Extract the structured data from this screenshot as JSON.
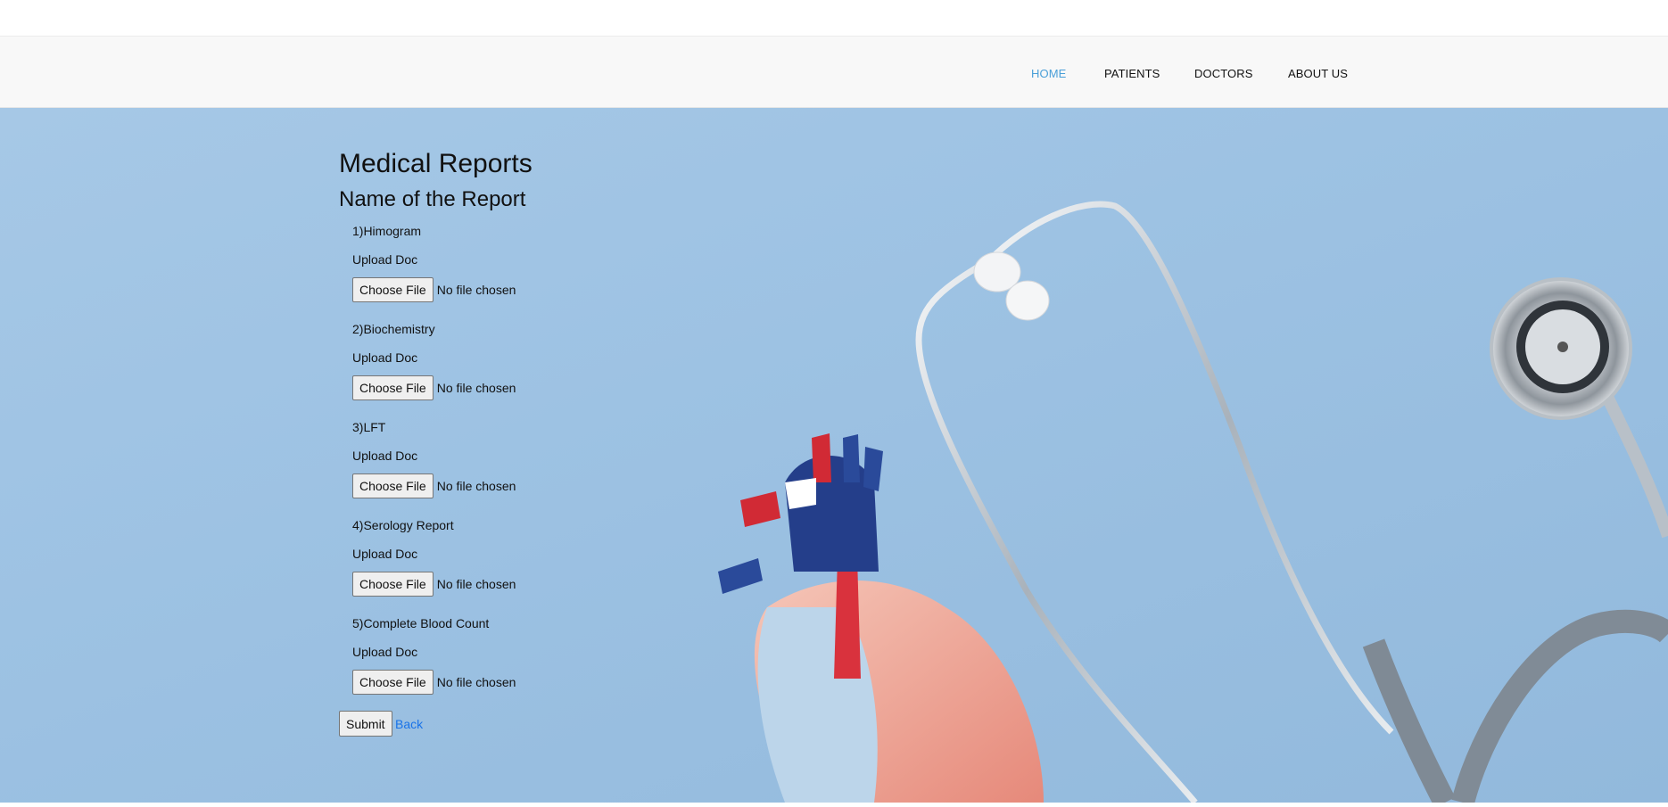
{
  "nav": {
    "items": [
      {
        "label": "HOME",
        "active": true
      },
      {
        "label": "PATIENTS",
        "active": false
      },
      {
        "label": "DOCTORS",
        "active": false
      },
      {
        "label": "ABOUT US",
        "active": false
      }
    ],
    "active_color": "#4a9fd8"
  },
  "page": {
    "title": "Medical Reports",
    "subtitle": "Name of the Report"
  },
  "reports": [
    {
      "name": "1)Himogram",
      "upload_label": "Upload Doc",
      "button": "Choose File",
      "status": "No file chosen"
    },
    {
      "name": "2)Biochemistry",
      "upload_label": "Upload Doc",
      "button": "Choose File",
      "status": "No file chosen"
    },
    {
      "name": "3)LFT",
      "upload_label": "Upload Doc",
      "button": "Choose File",
      "status": "No file chosen"
    },
    {
      "name": "4)Serology Report",
      "upload_label": "Upload Doc",
      "button": "Choose File",
      "status": "No file chosen"
    },
    {
      "name": "5)Complete Blood Count",
      "upload_label": "Upload Doc",
      "button": "Choose File",
      "status": "No file chosen"
    }
  ],
  "actions": {
    "submit_label": "Submit",
    "back_label": "Back"
  },
  "background": {
    "color": "#9dc2e3",
    "illustration": "stethoscope-and-heart-model"
  }
}
